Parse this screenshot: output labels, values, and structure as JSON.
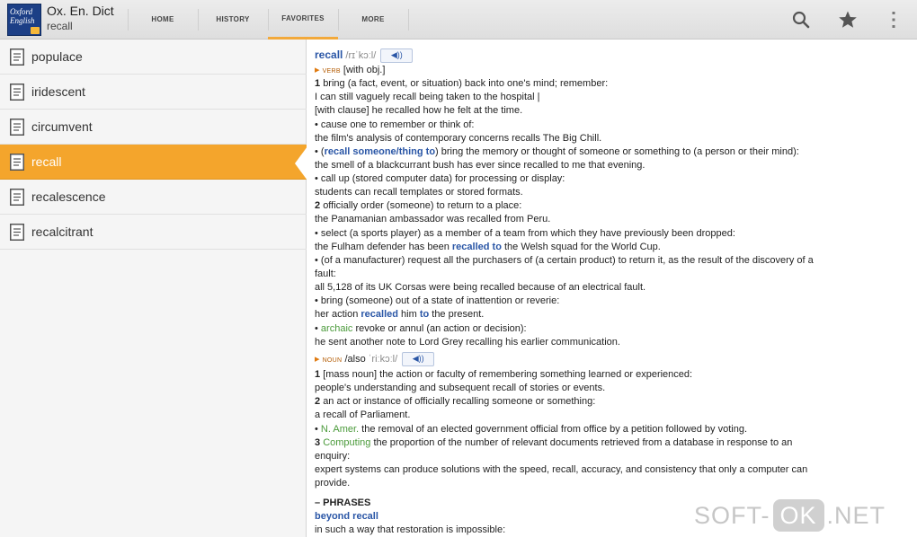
{
  "app": {
    "title": "Ox. En. Dict",
    "subtitle": "recall",
    "logo_text": "Oxford English"
  },
  "tabs": [
    {
      "label": "HOME"
    },
    {
      "label": "HISTORY"
    },
    {
      "label": "FAVORITES",
      "active": true
    },
    {
      "label": "MORE"
    }
  ],
  "actions": {
    "search_icon": "search-icon",
    "star_icon": "star-icon",
    "overflow_icon": "overflow-menu-icon"
  },
  "colors": {
    "accent": "#f4a52c",
    "link": "#2a56a6",
    "subject": "#4a9a3a"
  },
  "words": [
    {
      "label": "populace"
    },
    {
      "label": "iridescent"
    },
    {
      "label": "circumvent"
    },
    {
      "label": "recall",
      "selected": true
    },
    {
      "label": "recalescence"
    },
    {
      "label": "recalcitrant"
    }
  ],
  "entry": {
    "headword": "recall",
    "pron": "/rɪˈkɔːl/",
    "audio_glyph": "◀))",
    "verb_pos": "VERB",
    "verb_note": "[with obj.]",
    "l1_num": "1",
    "l1": "bring (a fact, event, or situation) back into one's mind; remember:",
    "l2": "I can still vaguely recall being taken to the hospital |",
    "l3": "[with clause] he recalled how he felt at the time.",
    "l4": "• cause one to remember or think of:",
    "l5": "the film's analysis of contemporary concerns recalls The Big Chill.",
    "l6_a": "• (",
    "l6_b": "recall someone/thing to",
    "l6_c": ") bring the memory or thought of someone or something to (a person or their mind):",
    "l7": "the smell of a blackcurrant bush has ever since recalled to me that evening.",
    "l8": "• call up (stored computer data) for processing or display:",
    "l9": "students can recall templates or stored formats.",
    "l10_num": "2",
    "l10": "officially order (someone) to return to a place:",
    "l11": "the Panamanian ambassador was recalled from Peru.",
    "l12": "• select (a sports player) as a member of a team from which they have previously been dropped:",
    "l13_a": "the Fulham defender has been ",
    "l13_b": "recalled to",
    "l13_c": " the Welsh squad for the World Cup.",
    "l14": "• (of a manufacturer) request all the purchasers of (a certain product) to return it, as the result of the discovery of a",
    "l15": "fault:",
    "l16": "all 5,128 of its UK Corsas were being recalled because of an electrical fault.",
    "l17": "• bring (someone) out of a state of inattention or reverie:",
    "l18_a": "her action ",
    "l18_b": "recalled",
    "l18_c": " him ",
    "l18_d": "to",
    "l18_e": " the present.",
    "l19_a": "• ",
    "l19_b": "archaic",
    "l19_c": " revoke or annul (an action or decision):",
    "l20": "he sent another note to Lord Grey recalling his earlier communication.",
    "noun_pos": "NOUN",
    "noun_also": "/also",
    "noun_pron": "ˈriːkɔːl/",
    "n1_num": "1",
    "n1": "[mass noun] the action or faculty of remembering something learned or experienced:",
    "n2": "people's understanding and subsequent recall of stories or events.",
    "n3_num": "2",
    "n3": "an act or instance of officially recalling someone or something:",
    "n4": "a recall of Parliament.",
    "n5_a": "• ",
    "n5_b": "N. Amer.",
    "n5_c": " the removal of an elected government official from office by a petition followed by voting.",
    "n6_num": "3",
    "n6_b": "Computing",
    "n6_c": " the proportion of the number of relevant documents retrieved from a database in response to an",
    "n7": "enquiry:",
    "n8": "expert systems can produce solutions with the speed, recall, accuracy, and consistency that only a computer can",
    "n9": "provide.",
    "phrases_head": "– PHRASES",
    "phrase1": "beyond recall",
    "phrase1_def": "in such a way that restoration is impossible:"
  },
  "watermark": {
    "left": "SOFT-",
    "box": "OK",
    "right": ".NET"
  }
}
